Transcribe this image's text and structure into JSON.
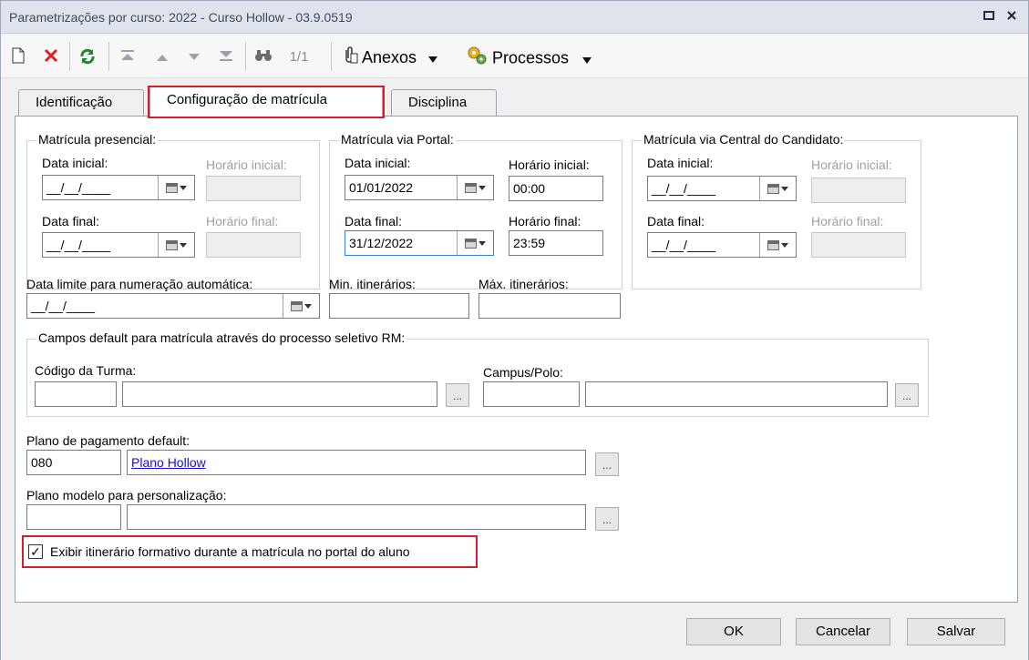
{
  "window": {
    "title": "Parametrizações por curso: 2022 - Curso Hollow - 03.9.0519"
  },
  "toolbar": {
    "record_counter": "1/1",
    "attachments_label": "Anexos",
    "processes_label": "Processos",
    "icons": [
      "new-icon",
      "delete-icon",
      "refresh-icon",
      "first-icon",
      "prev-icon",
      "next-icon",
      "last-icon",
      "binoculars-icon",
      "paperclip-icon",
      "gears-icon"
    ]
  },
  "tabs": [
    {
      "label": "Identificação"
    },
    {
      "label": "Configuração de matrícula",
      "active": true
    },
    {
      "label": "Disciplina"
    }
  ],
  "groups": {
    "presencial": {
      "title": "Matrícula presencial:",
      "start_label": "Data inicial:",
      "start_value": "__/__/____",
      "start_time_label": "Horário inicial:",
      "start_time_value": "",
      "end_label": "Data final:",
      "end_value": "__/__/____",
      "end_time_label": "Horário final:",
      "end_time_value": ""
    },
    "portal": {
      "title": "Matrícula via Portal:",
      "start_label": "Data inicial:",
      "start_value": "01/01/2022",
      "start_time_label": "Horário inicial:",
      "start_time_value": "00:00",
      "end_label": "Data final:",
      "end_value": "31/12/2022",
      "end_time_label": "Horário final:",
      "end_time_value": "23:59"
    },
    "central": {
      "title": "Matrícula via Central do Candidato:",
      "start_label": "Data inicial:",
      "start_value": "__/__/____",
      "start_time_label": "Horário inicial:",
      "start_time_value": "",
      "end_label": "Data final:",
      "end_value": "__/__/____",
      "end_time_label": "Horário final:",
      "end_time_value": ""
    }
  },
  "numbering": {
    "date_limit_label": "Data limite para numeração automática:",
    "date_limit_value": "__/__/____",
    "min_label": "Min. itinerários:",
    "min_value": "",
    "max_label": "Máx. itinerários:",
    "max_value": ""
  },
  "defaults": {
    "title": "Campos default para matrícula através do processo seletivo RM:",
    "class_code_label": "Código da Turma:",
    "class_code_value": "",
    "class_name_value": "",
    "campus_label": "Campus/Polo:",
    "campus_code_value": "",
    "campus_name_value": ""
  },
  "payment": {
    "label": "Plano de pagamento default:",
    "code_value": "080",
    "name_value": "Plano Hollow"
  },
  "template_plan": {
    "label": "Plano modelo para personalização:",
    "code_value": "",
    "name_value": ""
  },
  "show_itinerary": {
    "label": "Exibir itinerário formativo durante a matrícula no portal do aluno",
    "checked": true,
    "mark": "✓"
  },
  "buttons": {
    "ok": "OK",
    "cancel": "Cancelar",
    "save": "Salvar"
  },
  "ellipsis": "...",
  "highlight_color": "#d11f2e"
}
